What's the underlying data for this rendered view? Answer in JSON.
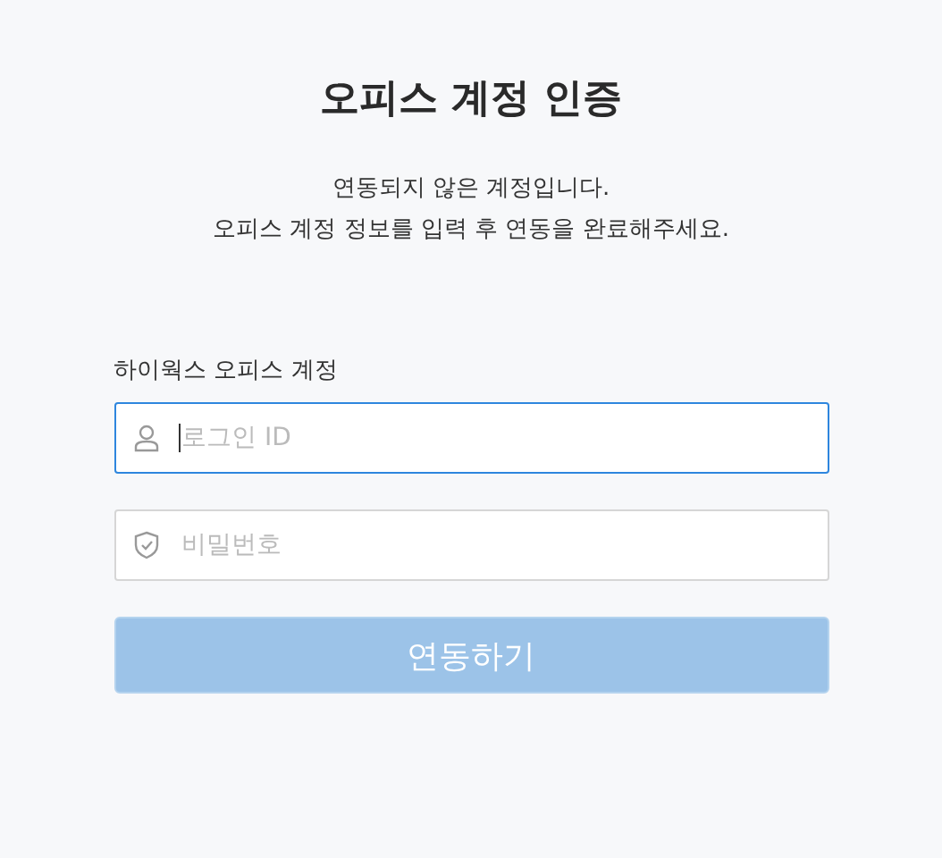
{
  "title": "오피스 계정 인증",
  "description": [
    "연동되지 않은 계정입니다.",
    "오피스 계정 정보를 입력 후 연동을 완료해주세요."
  ],
  "account_label": "하이웍스 오피스 계정",
  "fields": [
    {
      "kind": "user",
      "placeholder": "로그인 ID",
      "focused": true
    },
    {
      "kind": "password",
      "placeholder": "비밀번호",
      "focused": false
    }
  ],
  "submit": {
    "label": "연동하기",
    "disabled": true
  }
}
